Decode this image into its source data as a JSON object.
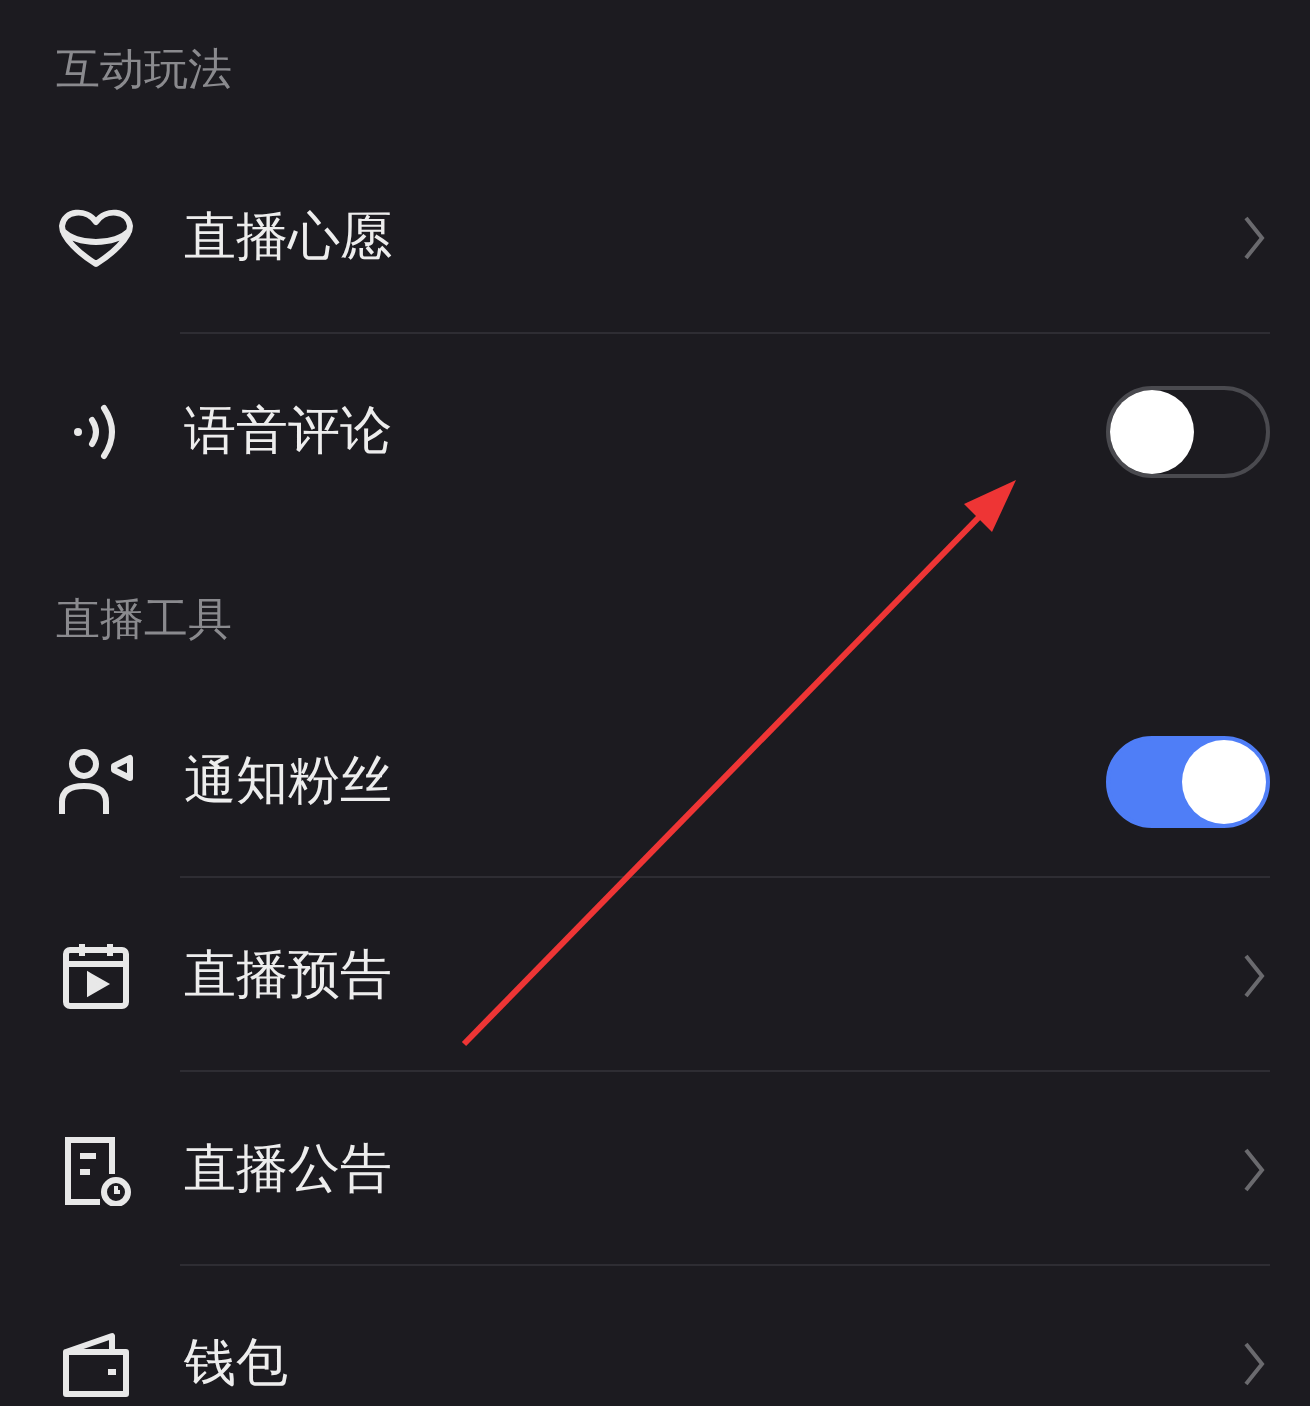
{
  "sections": [
    {
      "title": "互动玩法",
      "items": [
        {
          "label": "直播心愿",
          "kind": "link"
        },
        {
          "label": "语音评论",
          "kind": "toggle",
          "on": false
        }
      ]
    },
    {
      "title": "直播工具",
      "items": [
        {
          "label": "通知粉丝",
          "kind": "toggle",
          "on": true
        },
        {
          "label": "直播预告",
          "kind": "link"
        },
        {
          "label": "直播公告",
          "kind": "link"
        },
        {
          "label": "钱包",
          "kind": "link"
        }
      ]
    }
  ]
}
